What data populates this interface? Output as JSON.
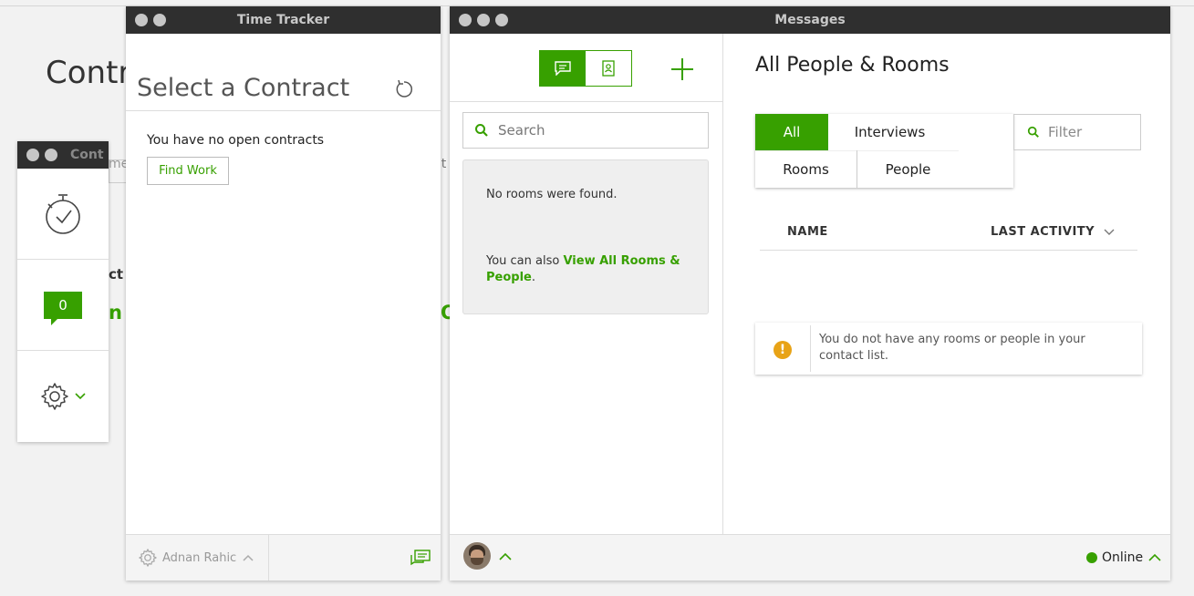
{
  "background": {
    "heading": "Contr",
    "fragment_ct": "ct",
    "fragment_n": "n",
    "fragment_o": "O",
    "fragment_me": "me",
    "fragment_ct2": "ct"
  },
  "mini_window": {
    "title": "Cont",
    "badge_count": "0"
  },
  "time_tracker": {
    "title": "Time Tracker",
    "heading": "Select a Contract",
    "empty_text": "You have no open contracts",
    "find_work_label": "Find Work",
    "user_name": "Adnan Rahic"
  },
  "messages": {
    "title": "Messages",
    "search_placeholder": "Search",
    "no_rooms": "No rooms were found.",
    "view_all_prefix": "You can also ",
    "view_all_link": "View All Rooms & People",
    "view_all_suffix": ".",
    "heading": "All People & Rooms",
    "tabs": {
      "all": "All",
      "interviews": "Interviews",
      "rooms": "Rooms",
      "people": "People"
    },
    "filter_placeholder": "Filter",
    "columns": {
      "name": "NAME",
      "last_activity": "LAST ACTIVITY"
    },
    "empty_notice": "You do not have any rooms or people in your contact list.",
    "status": "Online"
  },
  "colors": {
    "accent": "#37a000",
    "warning": "#e8a317",
    "titlebar": "#2f2f2f"
  }
}
